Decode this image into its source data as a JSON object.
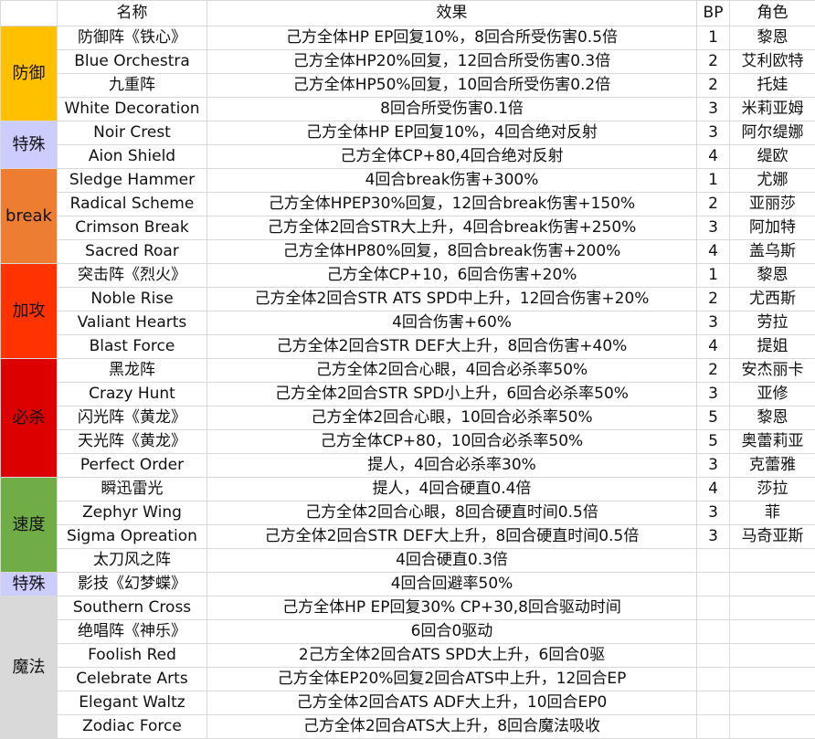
{
  "header": {
    "name": "名称",
    "effect": "效果",
    "bp": "BP",
    "role": "角色"
  },
  "groups": [
    {
      "label": "防御",
      "color": "#ffc000",
      "rows": [
        {
          "name": "防御阵《铁心》",
          "effect": "己方全体HP EP回复10%，8回合所受伤害0.5倍",
          "bp": "1",
          "role": "黎恩"
        },
        {
          "name": "Blue Orchestra",
          "effect": "己方全体HP20%回复，12回合所受伤害0.3倍",
          "bp": "2",
          "role": "艾利欧特"
        },
        {
          "name": "九重阵",
          "effect": "己方全体HP50%回复，10回合所受伤害0.2倍",
          "bp": "2",
          "role": "托娃"
        },
        {
          "name": "White Decoration",
          "effect": "8回合所受伤害0.1倍",
          "bp": "3",
          "role": "米莉亚姆"
        }
      ]
    },
    {
      "label": "特殊",
      "color": "#ccccff",
      "rows": [
        {
          "name": "Noir Crest",
          "effect": "己方全体HP EP回复10%，4回合绝对反射",
          "bp": "3",
          "role": "阿尔缇娜"
        },
        {
          "name": "Aion Shield",
          "effect": "己方全体CP+80,4回合绝对反射",
          "bp": "4",
          "role": "缇欧"
        }
      ]
    },
    {
      "label": "break",
      "color": "#ed7d31",
      "rows": [
        {
          "name": "Sledge Hammer",
          "effect": "4回合break伤害+300%",
          "bp": "1",
          "role": "尤娜"
        },
        {
          "name": "Radical Scheme",
          "effect": "己方全体HPEP30%回复，12回合break伤害+150%",
          "bp": "2",
          "role": "亚丽莎"
        },
        {
          "name": "Crimson Break",
          "effect": "己方全体2回合STR大上升，4回合break伤害+250%",
          "bp": "3",
          "role": "阿加特"
        },
        {
          "name": "Sacred Roar",
          "effect": "己方全体HP80%回复，8回合break伤害+200%",
          "bp": "4",
          "role": "盖乌斯"
        }
      ]
    },
    {
      "label": "加攻",
      "color": "#ff3300",
      "rows": [
        {
          "name": "突击阵《烈火》",
          "effect": "己方全体CP+10，6回合伤害+20%",
          "bp": "1",
          "role": "黎恩"
        },
        {
          "name": "Noble Rise",
          "effect": "己方全体2回合STR ATS SPD中上升，12回合伤害+20%",
          "bp": "2",
          "role": "尤西斯"
        },
        {
          "name": "Valiant Hearts",
          "effect": "4回合伤害+60%",
          "bp": "3",
          "role": "劳拉"
        },
        {
          "name": "Blast Force",
          "effect": "己方全体2回合STR DEF大上升，8回合伤害+40%",
          "bp": "4",
          "role": "提姐"
        }
      ]
    },
    {
      "label": "必杀",
      "color": "#dd0000",
      "rows": [
        {
          "name": "黑龙阵",
          "effect": "己方全体2回合心眼，4回合必杀率50%",
          "bp": "2",
          "role": "安杰丽卡"
        },
        {
          "name": "Crazy Hunt",
          "effect": "己方全体2回合STR SPD小上升，6回合必杀率50%",
          "bp": "3",
          "role": "亚修"
        },
        {
          "name": "闪光阵《黄龙》",
          "effect": "己方全体2回合心眼，10回合必杀率50%",
          "bp": "5",
          "role": "黎恩"
        },
        {
          "name": "天光阵《黄龙》",
          "effect": "己方全体CP+80，10回合必杀率50%",
          "bp": "5",
          "role": "奥蕾莉亚"
        },
        {
          "name": "Perfect Order",
          "effect": "提人，4回合必杀率30%",
          "bp": "3",
          "role": "克蕾雅"
        }
      ]
    },
    {
      "label": "速度",
      "color": "#70ad47",
      "rows": [
        {
          "name": "瞬迅雷光",
          "effect": "提人，4回合硬直0.4倍",
          "bp": "4",
          "role": "莎拉"
        },
        {
          "name": "Zephyr Wing",
          "effect": "己方全体2回合心眼，8回合硬直时间0.5倍",
          "bp": "3",
          "role": "菲"
        },
        {
          "name": "Sigma Opreation",
          "effect": "己方全体2回合STR DEF大上升，8回合硬直时间0.5倍",
          "bp": "3",
          "role": "马奇亚斯"
        },
        {
          "name": "太刀风之阵",
          "effect": "4回合硬直0.3倍",
          "bp": "",
          "role": ""
        }
      ]
    },
    {
      "label": "特殊",
      "color": "#ccccff",
      "rows": [
        {
          "name": "影技《幻梦蝶》",
          "effect": "4回合回避率50%",
          "bp": "",
          "role": ""
        }
      ]
    },
    {
      "label": "魔法",
      "color": "#d9d9d9",
      "rows": [
        {
          "name": "Southern Cross",
          "effect": "己方全体HP EP回复30% CP+30,8回合驱动时间",
          "bp": "",
          "role": ""
        },
        {
          "name": "绝唱阵《神乐》",
          "effect": "6回合0驱动",
          "bp": "",
          "role": ""
        },
        {
          "name": "Foolish Red",
          "effect": "2己方全体2回合ATS SPD大上升，6回合0驱",
          "bp": "",
          "role": ""
        },
        {
          "name": "Celebrate Arts",
          "effect": "己方全体EP20%回复2回合ATS中上升，12回合EP",
          "bp": "",
          "role": ""
        },
        {
          "name": "Elegant Waltz",
          "effect": "己方全体2回合ATS ADF大上升，10回合EP0",
          "bp": "",
          "role": ""
        },
        {
          "name": "Zodiac Force",
          "effect": "己方全体2回合ATS大上升，8回合魔法吸收",
          "bp": "",
          "role": ""
        }
      ]
    }
  ]
}
